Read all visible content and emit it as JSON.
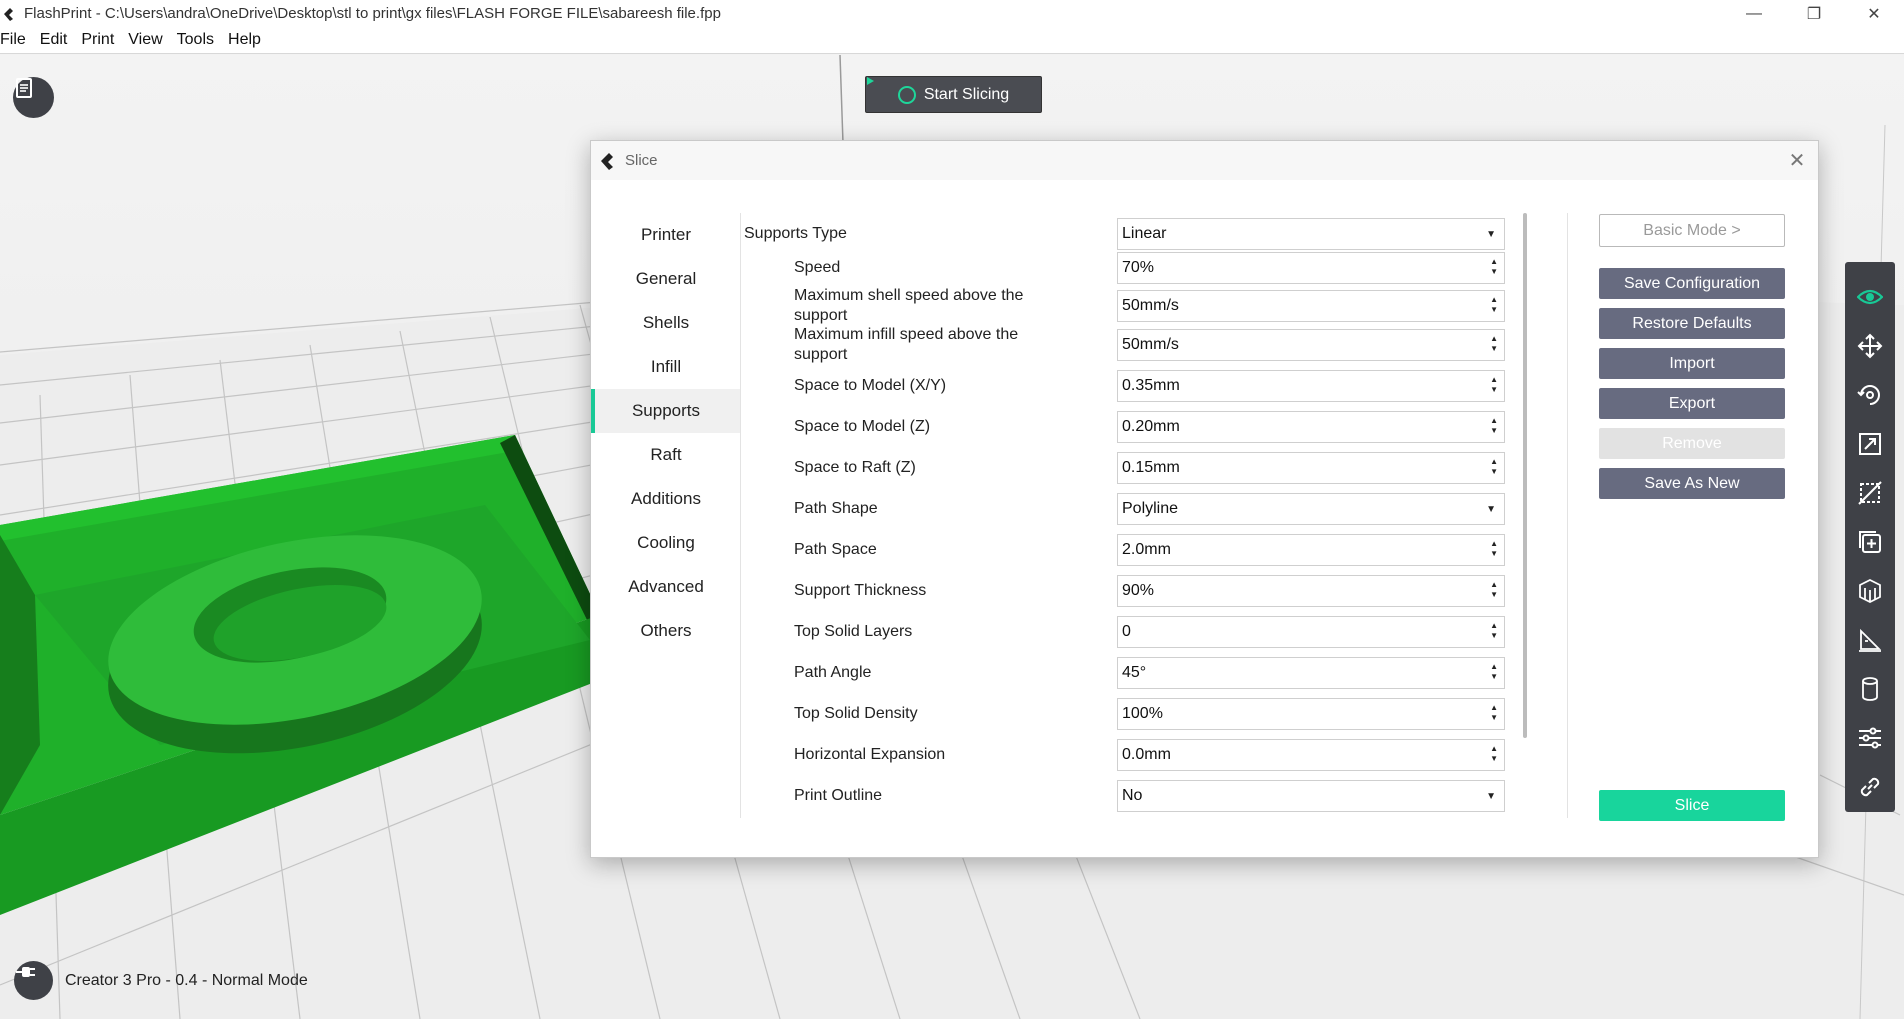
{
  "window": {
    "title": "FlashPrint - C:\\Users\\andra\\OneDrive\\Desktop\\stl to print\\gx files\\FLASH FORGE FILE\\sabareesh file.fpp"
  },
  "menu": [
    "File",
    "Edit",
    "Print",
    "View",
    "Tools",
    "Help"
  ],
  "toolbar": {
    "start_slicing": "Start Slicing"
  },
  "status": {
    "printer": "Creator 3 Pro - 0.4 - Normal Mode"
  },
  "dialog": {
    "title": "Slice",
    "tabs": [
      "Printer",
      "General",
      "Shells",
      "Infill",
      "Supports",
      "Raft",
      "Additions",
      "Cooling",
      "Advanced",
      "Others"
    ],
    "active_tab": "Supports",
    "settings": [
      {
        "label": "Supports Type",
        "value": "Linear",
        "control": "select"
      },
      {
        "label": "Speed",
        "value": "70%",
        "control": "spin"
      },
      {
        "label": "Maximum shell speed above the support",
        "value": "50mm/s",
        "control": "spin"
      },
      {
        "label": "Maximum infill speed above the support",
        "value": "50mm/s",
        "control": "spin"
      },
      {
        "label": "Space to Model (X/Y)",
        "value": "0.35mm",
        "control": "spin"
      },
      {
        "label": "Space to Model (Z)",
        "value": "0.20mm",
        "control": "spin"
      },
      {
        "label": "Space to Raft (Z)",
        "value": "0.15mm",
        "control": "spin"
      },
      {
        "label": "Path Shape",
        "value": "Polyline",
        "control": "select"
      },
      {
        "label": "Path Space",
        "value": "2.0mm",
        "control": "spin"
      },
      {
        "label": "Support Thickness",
        "value": "90%",
        "control": "spin"
      },
      {
        "label": "Top Solid Layers",
        "value": "0",
        "control": "spin"
      },
      {
        "label": "Path Angle",
        "value": "45°",
        "control": "spin"
      },
      {
        "label": "Top Solid Density",
        "value": "100%",
        "control": "spin"
      },
      {
        "label": "Horizontal Expansion",
        "value": "0.0mm",
        "control": "spin"
      },
      {
        "label": "Print Outline",
        "value": "No",
        "control": "select"
      }
    ],
    "buttons": {
      "basic_mode": "Basic Mode >",
      "save_configuration": "Save Configuration",
      "restore_defaults": "Restore Defaults",
      "import": "Import",
      "export": "Export",
      "remove": "Remove",
      "save_as_new": "Save As New",
      "slice": "Slice"
    }
  },
  "right_tools": [
    "eye-icon",
    "move-icon",
    "rotate-icon",
    "scale-icon",
    "cut-icon",
    "add-model-icon",
    "support-icon",
    "measure-icon",
    "cylinder-icon",
    "settings-sliders-icon",
    "link-icon"
  ],
  "colors": {
    "accent": "#18c996",
    "model_green": "#1fb02a",
    "dark_button": "#676b80",
    "toolbar_bg": "#3f4147"
  }
}
